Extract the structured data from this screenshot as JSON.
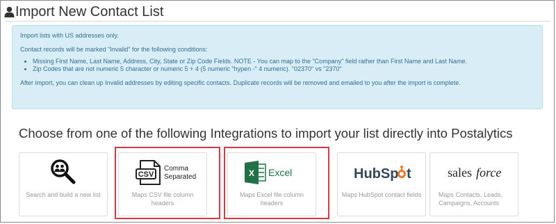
{
  "page": {
    "title": "Import New Contact List"
  },
  "info": {
    "line1": "Import lists with US addresses only.",
    "line2": "Contact records will be marked \"Invalid\" for the following conditions:",
    "bullets": [
      "Missing First Name, Last Name, Address, City, State or Zip Code Fields. NOTE - You can map to the \"Company\" field rather than First Name and Last Name.",
      "Zip Codes that are not numeric 5 character or numeric 5 + 4 (5 numeric \"hypen -\" 4 numeric). \"02370\" vs \"2370\""
    ],
    "line3": "After import, you can clean up Invalid addresses by editing specific contacts. Duplicate records will be removed and emailed to you after the import is complete."
  },
  "integrations": {
    "heading": "Choose from one of the following Integrations to import your list directly into Postalytics",
    "cards": [
      {
        "id": "search",
        "icon": "search-people-icon",
        "description": "Search and build a new list"
      },
      {
        "id": "csv",
        "icon": "csv-file-icon",
        "logo_text_line1": "Comma",
        "logo_text_line2": "Separated",
        "badge": "CSV",
        "description": "Maps CSV file column headers"
      },
      {
        "id": "excel",
        "icon": "excel-icon",
        "logo_text": "Excel",
        "description": "Maps Excel file column headers"
      },
      {
        "id": "hubspot",
        "icon": "hubspot-logo",
        "logo_text_a": "HubSp",
        "logo_text_b": "t",
        "description": "Maps HubSpot contact fields"
      },
      {
        "id": "salesforce",
        "icon": "salesforce-logo",
        "logo_text_a": "sales",
        "logo_text_b": "force",
        "description": "Maps Contacts, Leads, Campaigns, Accounts"
      }
    ]
  },
  "colors": {
    "info_bg": "#d9edf7",
    "info_text": "#31708f",
    "highlight": "#d9383f",
    "excel_green": "#1f7244",
    "hubspot_orange": "#f57722",
    "hubspot_dark": "#33475b"
  }
}
